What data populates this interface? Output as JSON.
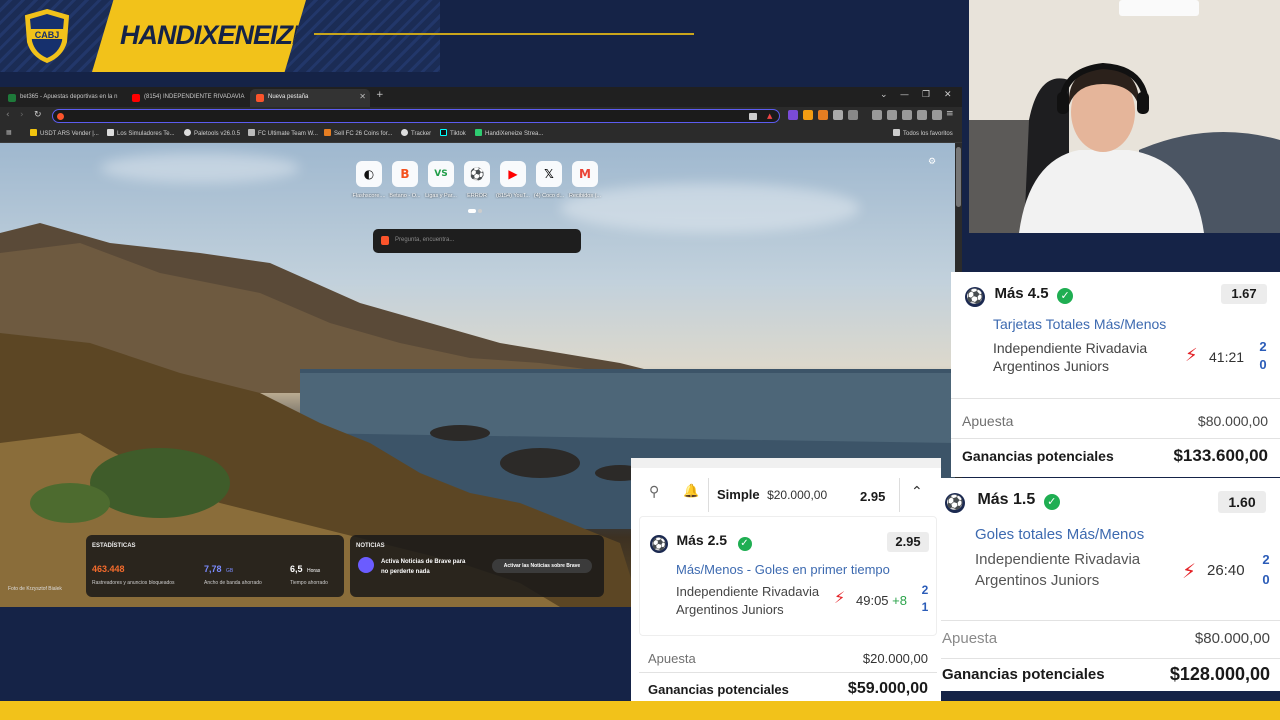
{
  "overlay": {
    "brand": "HANDIXENEIZE",
    "crest_text": "CABJ",
    "colors": {
      "navy": "#152347",
      "gold": "#f2c21a"
    }
  },
  "browser": {
    "tabs": [
      {
        "title": "bet365 - Apuestas deportivas en la n",
        "icon": "bet365-icon",
        "active": false
      },
      {
        "title": "(8154) INDEPENDIENTE RIVADAVIA",
        "icon": "youtube-icon",
        "active": false
      },
      {
        "title": "Nueva pestaña",
        "icon": "brave-icon",
        "active": true
      }
    ],
    "new_tab_symbol": "+",
    "window_controls": {
      "tabs_menu": "⌄",
      "minimize": "—",
      "restore": "❐",
      "close": "✕"
    },
    "bookmarks": [
      "USDT ARS Vender |...",
      "Los Simuladores Te...",
      "Paletools v26.0.5",
      "FC Ultimate Team W...",
      "Sell FC 26 Coins for...",
      "Tracker",
      "Tiktok",
      "HandiXeneize Strea..."
    ],
    "all_bookmarks": "Todos los favoritos",
    "shortcuts": [
      {
        "label": "Flashscore....",
        "icon": "flashscore-icon",
        "glyph": "◐",
        "color": "#111111"
      },
      {
        "label": "Betano - O...",
        "icon": "betano-icon",
        "glyph": "B",
        "color": "#f4511e"
      },
      {
        "label": "Ligas y Par...",
        "icon": "vs-icon",
        "glyph": "VS",
        "color": "#1f9d48"
      },
      {
        "label": "ERROR",
        "icon": "error-icon",
        "glyph": "⚽",
        "color": "#2e9e4f"
      },
      {
        "label": "(8154) YouT...",
        "icon": "youtube-icon",
        "glyph": "▶",
        "color": "#ff0000"
      },
      {
        "label": "(4) Coco d...",
        "icon": "x-icon",
        "glyph": "𝕏",
        "color": "#000000"
      },
      {
        "label": "Recibidos (...",
        "icon": "gmail-icon",
        "glyph": "M",
        "color": "#ea4335"
      }
    ],
    "search_placeholder": "Pregunta, encuentra...",
    "stats": {
      "title": "ESTADÍSTICAS",
      "items": [
        {
          "value": "463.448",
          "unit": "",
          "label": "Rastreadores y anuncios bloqueados",
          "color": "#f36b2c"
        },
        {
          "value": "7,78",
          "unit": "GB",
          "label": "Ancho de banda ahorrado",
          "color": "#7b8cff"
        },
        {
          "value": "6,5",
          "unit": "Horas",
          "label": "Tiempo ahorrado",
          "color": "#ffffff"
        }
      ]
    },
    "news": {
      "title": "NOTICIAS",
      "text_line1": "Activa Noticias de Brave para",
      "text_line2": "no perderte nada",
      "button": "Activar las Noticias sobre Brave"
    },
    "photo_credit": "Foto de Krzysztof Bialek"
  },
  "betslip_main": {
    "type_label": "Simple",
    "stake_header": "$20.000,00",
    "total_odds": "2.95",
    "selection": "Más 2.5",
    "odds": "2.95",
    "market": "Más/Menos - Goles en primer tiempo",
    "team_home": "Independiente Rivadavia",
    "team_away": "Argentinos Juniors",
    "clock": "49:05",
    "added": "+8",
    "score_home": "2",
    "score_away": "1",
    "stake_label": "Apuesta",
    "stake": "$20.000,00",
    "returns_label": "Ganancias potenciales",
    "returns": "$59.000,00"
  },
  "bet_card_1": {
    "selection": "Más 4.5",
    "odds": "1.67",
    "market": "Tarjetas Totales Más/Menos",
    "team_home": "Independiente Rivadavia",
    "team_away": "Argentinos Juniors",
    "clock": "41:21",
    "score_home": "2",
    "score_away": "0",
    "stake_label": "Apuesta",
    "stake": "$80.000,00",
    "returns_label": "Ganancias potenciales",
    "returns": "$133.600,00"
  },
  "bet_card_2": {
    "selection": "Más 1.5",
    "odds": "1.60",
    "market": "Goles totales Más/Menos",
    "team_home": "Independiente Rivadavia",
    "team_away": "Argentinos Juniors",
    "clock": "26:40",
    "score_home": "2",
    "score_away": "0",
    "stake_label": "Apuesta",
    "stake": "$80.000,00",
    "returns_label": "Ganancias potenciales",
    "returns": "$128.000,00"
  }
}
